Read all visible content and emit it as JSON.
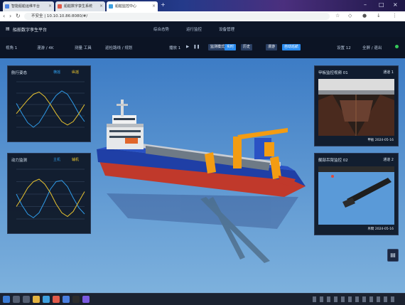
{
  "browser": {
    "tabs": [
      {
        "label": "智能船舶运维平台",
        "icon_color": "#4a7fe0"
      },
      {
        "label": "船舶数字孪生系统",
        "icon_color": "#e05a4a"
      },
      {
        "label": "船舶监控中心",
        "icon_color": "#3fa0e0",
        "active": true
      }
    ],
    "new_tab_icon": "plus-icon",
    "url": "不安全 | 10.10.10.86:8080/#/",
    "window_controls": [
      "minimize-icon",
      "maximize-icon",
      "close-icon"
    ]
  },
  "app": {
    "title": "船舶数字孪生平台",
    "nav": [
      "综合态势",
      "运行监控",
      "设备管理"
    ],
    "toolbar": {
      "left": [
        "视角 1",
        "漫游 / 4K",
        "测量 工具",
        "巡检路线 / 规划"
      ],
      "playback_label": "播放 1",
      "pills": [
        {
          "label": "监测模式",
          "color": "#2a3f63"
        },
        {
          "label": "实时",
          "color": "#2a8cf0"
        },
        {
          "label": "历史",
          "color": "#2a3f63"
        },
        {
          "label": "漫游",
          "color": "#2a3f63"
        },
        {
          "label": "自动巡航",
          "color": "#2a8cf0"
        }
      ],
      "right": [
        "设置 12",
        "全屏 / 退出"
      ],
      "status_color": "#35c95a"
    }
  },
  "panels": {
    "chart1": {
      "title": "航行姿态",
      "legend": [
        "横摇",
        "纵摇"
      ]
    },
    "chart2": {
      "title": "动力监测",
      "legend": [
        "主机",
        "辅机"
      ]
    },
    "camera1": {
      "title": "甲板监控视频 01",
      "badge": "通道 1",
      "caption": "甲板 2024-05-16"
    },
    "camera2": {
      "title": "艉部吊臂监控 02",
      "badge": "通道 2",
      "caption": "吊臂 2024-05-16"
    }
  },
  "chart_data": [
    {
      "type": "line",
      "title": "航行姿态",
      "x": [
        0,
        1,
        2,
        3,
        4,
        5,
        6,
        7,
        8,
        9,
        10,
        11,
        12
      ],
      "series": [
        {
          "name": "横摇",
          "color": "#2f9be8",
          "values": [
            2.1,
            1.2,
            0.4,
            0.0,
            0.4,
            1.2,
            2.1,
            2.8,
            3.2,
            2.9,
            2.1,
            1.2,
            0.5
          ]
        },
        {
          "name": "纵摇",
          "color": "#e8c32f",
          "values": [
            1.2,
            1.8,
            2.4,
            2.9,
            3.1,
            2.7,
            2.0,
            1.2,
            0.5,
            0.2,
            0.5,
            1.2,
            2.0
          ]
        }
      ],
      "ylim": [
        0,
        4
      ],
      "grid": true
    },
    {
      "type": "line",
      "title": "动力监测",
      "x": [
        0,
        1,
        2,
        3,
        4,
        5,
        6,
        7,
        8,
        9,
        10,
        11,
        12
      ],
      "series": [
        {
          "name": "主机",
          "color": "#2f9be8",
          "values": [
            2.0,
            1.1,
            0.4,
            0.1,
            0.5,
            1.4,
            2.4,
            3.0,
            3.1,
            2.6,
            1.7,
            0.9,
            0.4
          ]
        },
        {
          "name": "辅机",
          "color": "#e8c32f",
          "values": [
            1.0,
            1.7,
            2.5,
            3.0,
            3.2,
            2.8,
            2.1,
            1.2,
            0.5,
            0.2,
            0.6,
            1.4,
            2.2
          ]
        }
      ],
      "ylim": [
        0,
        4
      ],
      "grid": true
    }
  ],
  "taskbar": {
    "apps": [
      {
        "icon": "windows-start-icon",
        "color": "#3a7bd5"
      },
      {
        "icon": "search-icon",
        "color": "#555f72"
      },
      {
        "icon": "task-view-icon",
        "color": "#555f72"
      },
      {
        "icon": "folder-icon",
        "color": "#e3b341"
      },
      {
        "icon": "browser-icon",
        "color": "#3fa0e0"
      },
      {
        "icon": "chrome-icon",
        "color": "#e05a4a"
      },
      {
        "icon": "mail-icon",
        "color": "#4a7fe0"
      },
      {
        "icon": "terminal-icon",
        "color": "#2c2c2c"
      },
      {
        "icon": "app-icon",
        "color": "#7a5ae0"
      }
    ],
    "tray_icon": "clipboard-icon"
  }
}
